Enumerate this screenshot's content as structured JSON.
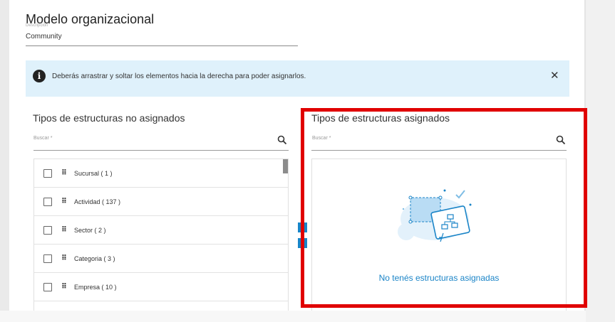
{
  "form": {
    "title": "Modelo organizacional",
    "description_label": "Descripción",
    "description_value": "Community"
  },
  "info_banner": {
    "icon": "info-icon",
    "text": "Deberás arrastrar y soltar los elementos hacia la derecha para poder asignarlos.",
    "close_label": "✕"
  },
  "unassigned": {
    "title": "Tipos de estructuras no asignados",
    "search_label": "Buscar *",
    "items": [
      {
        "label": "Sucursal ( 1 )"
      },
      {
        "label": "Actividad ( 137 )"
      },
      {
        "label": "Sector ( 2 )"
      },
      {
        "label": "Categoria ( 3 )"
      },
      {
        "label": "Empresa ( 10 )"
      }
    ]
  },
  "assigned": {
    "title": "Tipos de estructuras asignados",
    "search_label": "Buscar *",
    "empty_message": "No tenés estructuras asignadas"
  },
  "colors": {
    "accent": "#1a84c7",
    "banner_bg": "#dff1fb",
    "highlight": "#e00000"
  }
}
